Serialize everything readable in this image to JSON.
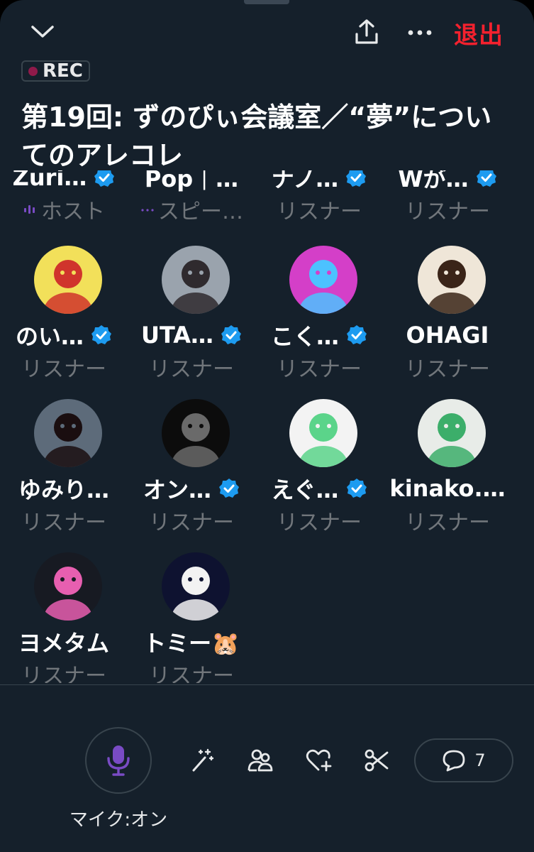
{
  "header": {
    "leave_label": "退出",
    "rec_label": "REC",
    "title": "第19回: ずのぴぃ会議室／“夢”についてのアレコレ"
  },
  "colors": {
    "background": "#15202b",
    "accent_purple": "#794bc4",
    "verified_blue": "#1d9bf0",
    "leave_red": "#f4212e",
    "muted": "#71767b"
  },
  "participants": [
    {
      "name": "Zuri…",
      "role": "ホスト",
      "verified": true,
      "role_icon": "host-bars-icon"
    },
    {
      "name": "Pop｜…",
      "role": "スピー…",
      "verified": false,
      "role_icon": "speaker-dots-icon"
    },
    {
      "name": "ナノ…",
      "role": "リスナー",
      "verified": true
    },
    {
      "name": "Wが…",
      "role": "リスナー",
      "verified": true
    },
    {
      "name": "のい…",
      "role": "リスナー",
      "verified": true
    },
    {
      "name": "UTA…",
      "role": "リスナー",
      "verified": true
    },
    {
      "name": "こく…",
      "role": "リスナー",
      "verified": true
    },
    {
      "name": "OHAGI",
      "role": "リスナー",
      "verified": false
    },
    {
      "name": "ゆみり…",
      "role": "リスナー",
      "verified": false
    },
    {
      "name": "オン…",
      "role": "リスナー",
      "verified": true
    },
    {
      "name": "えぐ…",
      "role": "リスナー",
      "verified": true
    },
    {
      "name": "kinako.…",
      "role": "リスナー",
      "verified": false
    },
    {
      "name": "ヨメタム",
      "role": "リスナー",
      "verified": false
    },
    {
      "name": "トミー🐹",
      "role": "リスナー",
      "verified": false
    }
  ],
  "controls": {
    "mic_label": "マイク:オン",
    "comment_count": "7"
  }
}
